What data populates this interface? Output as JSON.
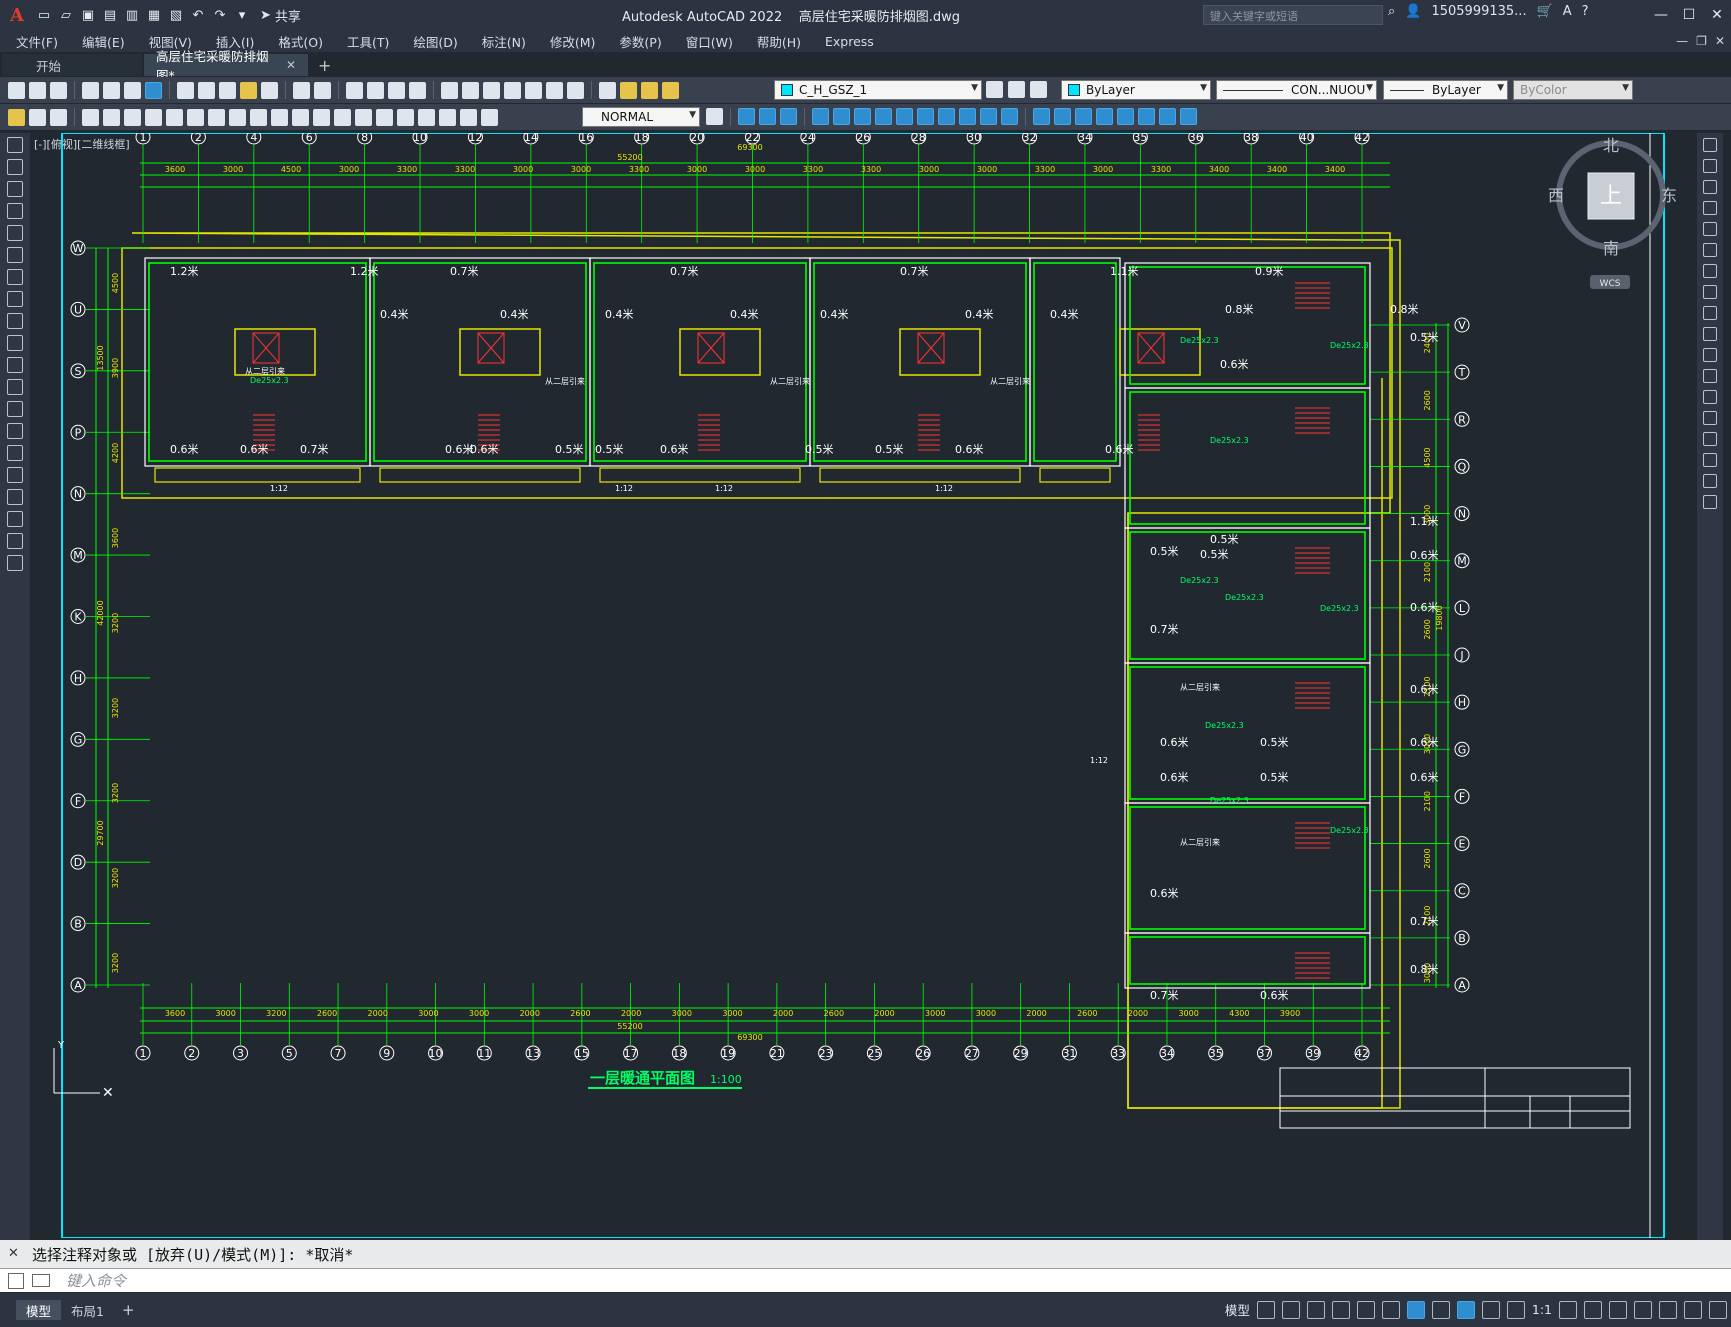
{
  "titlebar": {
    "share_label": "共享",
    "app_name": "Autodesk AutoCAD 2022",
    "file_name": "高层住宅采暖防排烟图.dwg",
    "search_placeholder": "键入关键字或短语",
    "user": "1505999135...",
    "help_icon": "help-icon"
  },
  "menu": [
    "文件(F)",
    "编辑(E)",
    "视图(V)",
    "插入(I)",
    "格式(O)",
    "工具(T)",
    "绘图(D)",
    "标注(N)",
    "修改(M)",
    "参数(P)",
    "窗口(W)",
    "帮助(H)",
    "Express"
  ],
  "tabs": {
    "start": "开始",
    "active": "高层住宅采暖防排烟图*"
  },
  "toolbar": {
    "layer": "C_H_GSZ_1",
    "color": "ByLayer",
    "linetype": "CON...NUOU",
    "lineweight": "ByLayer",
    "plotstyle": "ByColor",
    "dimstyle": "NORMAL"
  },
  "viewport": {
    "label": "[-][俯视][二维线框]"
  },
  "viewcube": {
    "north": "北",
    "south": "南",
    "east": "东",
    "west": "西",
    "top": "上",
    "wcs": "WCS"
  },
  "drawing": {
    "title": "一层暖通平面图",
    "scale": "1:100",
    "col_top": [
      "1",
      "2",
      "4",
      "6",
      "8",
      "10",
      "12",
      "14",
      "16",
      "18",
      "20",
      "22",
      "24",
      "26",
      "28",
      "30",
      "32",
      "34",
      "35",
      "36",
      "38",
      "40",
      "42"
    ],
    "col_bottom": [
      "1",
      "2",
      "3",
      "5",
      "7",
      "9",
      "10",
      "11",
      "13",
      "15",
      "17",
      "18",
      "19",
      "21",
      "23",
      "25",
      "26",
      "27",
      "29",
      "31",
      "33",
      "34",
      "35",
      "37",
      "39",
      "42"
    ],
    "rows_left": [
      "W",
      "U",
      "S",
      "P",
      "N",
      "M",
      "K",
      "H",
      "G",
      "F",
      "D",
      "B",
      "A"
    ],
    "rows_right": [
      "V",
      "T",
      "R",
      "Q",
      "N",
      "M",
      "L",
      "J",
      "H",
      "G",
      "F",
      "E",
      "C",
      "B",
      "A"
    ],
    "dims_top": [
      "3600",
      "3000",
      "4500",
      "3000",
      "3300",
      "3300",
      "3000",
      "3000",
      "3300",
      "3000",
      "3000",
      "3300",
      "3300",
      "3000",
      "3000",
      "3300",
      "3000",
      "3300",
      "3400",
      "3400",
      "3400"
    ],
    "dim_total_top": "69300",
    "dim_sub_top": "55200",
    "dims_bottom": [
      "3600",
      "3000",
      "3200",
      "2600",
      "2000",
      "3000",
      "3000",
      "2000",
      "2600",
      "2000",
      "3000",
      "3000",
      "2000",
      "2600",
      "2000",
      "3000",
      "3000",
      "2000",
      "2600",
      "2000",
      "3000",
      "4300",
      "3900"
    ],
    "dim_total_bottom": "69300",
    "dim_sub_bottom": "55200",
    "dims_left": [
      "4500",
      "3900",
      "4200",
      "3600",
      "3200",
      "3200",
      "3200",
      "3200",
      "3200"
    ],
    "dims_left_total": [
      "13500",
      "42000",
      "29700"
    ],
    "dims_right": [
      "2400",
      "2600",
      "4500",
      "3000",
      "2100",
      "2600",
      "2100",
      "3000",
      "2100",
      "2600",
      "2100",
      "3000"
    ],
    "dim_right_total": "19800",
    "room_labels": [
      "1.2米",
      "0.7米",
      "0.4米",
      "0.6米",
      "0.5米",
      "0.8米",
      "0.9米",
      "1.1米"
    ],
    "pipe_label": "De25x2.3",
    "riser_label": "从二层引来",
    "ramp_label": "1:12"
  },
  "command": {
    "history": "选择注释对象或 [放弃(U)/模式(M)]: *取消*",
    "placeholder": "键入命令"
  },
  "status": {
    "model_tab": "模型",
    "layout_tab": "布局1",
    "model_label": "模型",
    "scale_label": "1:1"
  }
}
